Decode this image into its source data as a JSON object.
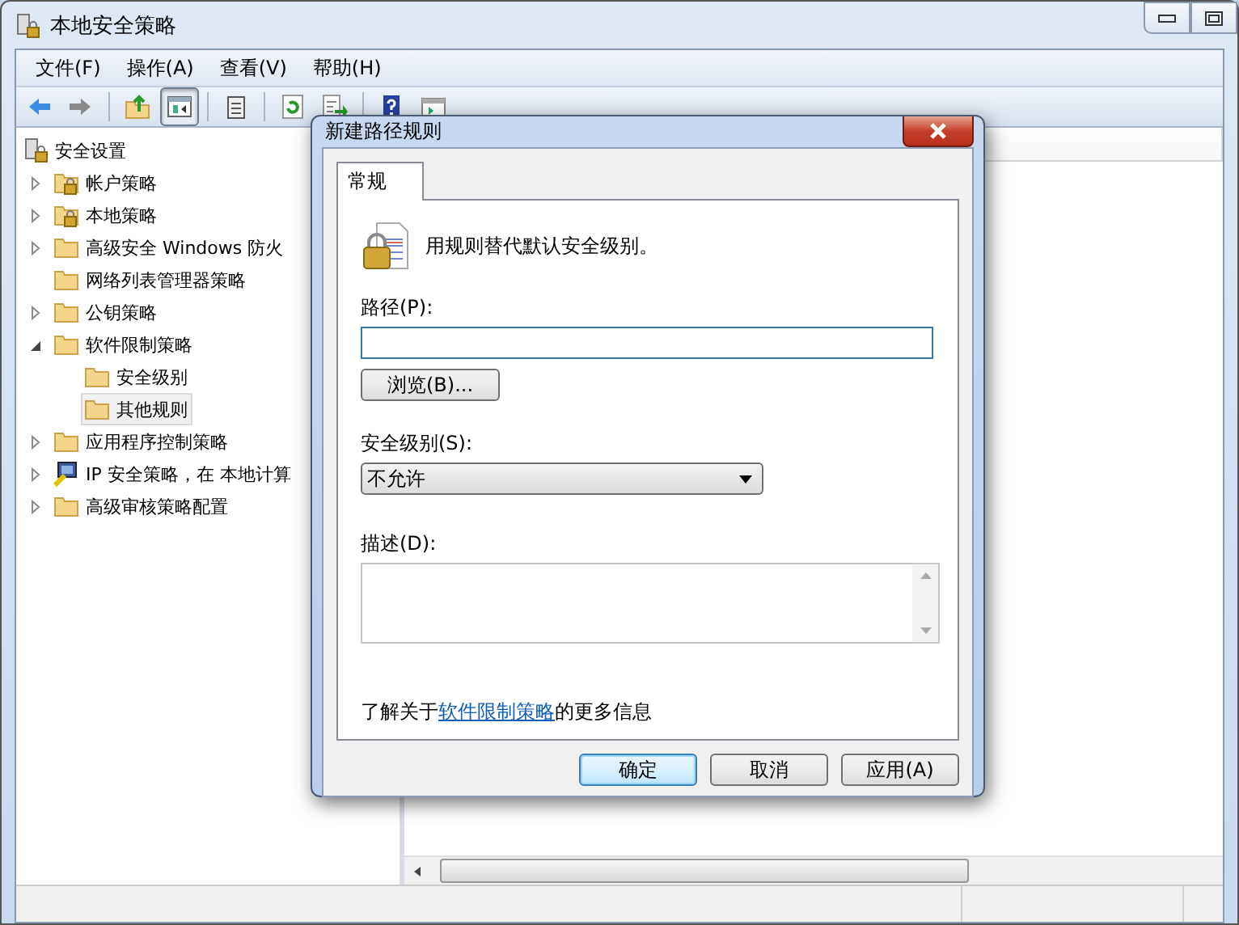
{
  "window": {
    "title": "本地安全策略"
  },
  "menu": [
    "文件(F)",
    "操作(A)",
    "查看(V)",
    "帮助(H)"
  ],
  "toolbar": [
    {
      "kind": "back",
      "pressed": false
    },
    {
      "kind": "forward",
      "pressed": false
    },
    {
      "kind": "up",
      "pressed": false
    },
    {
      "kind": "tree",
      "pressed": true
    },
    {
      "kind": "clipboard",
      "pressed": false
    },
    {
      "kind": "refresh",
      "pressed": false
    },
    {
      "kind": "export",
      "pressed": false
    },
    {
      "kind": "help",
      "pressed": false
    },
    {
      "kind": "panel",
      "pressed": false
    }
  ],
  "tree": [
    {
      "label": "安全设置",
      "kind": "policy",
      "selected": false,
      "children": [
        {
          "label": "帐户策略",
          "kind": "lock-folder",
          "selected": false,
          "expanded": false
        },
        {
          "label": "本地策略",
          "kind": "lock-folder",
          "selected": false,
          "expanded": false
        },
        {
          "label": "高级安全 Windows 防火",
          "kind": "folder",
          "selected": false,
          "expanded": false
        },
        {
          "label": "网络列表管理器策略",
          "kind": "folder",
          "selected": false
        },
        {
          "label": "公钥策略",
          "kind": "folder",
          "selected": false,
          "expanded": false
        },
        {
          "label": "软件限制策略",
          "kind": "folder",
          "selected": false,
          "expanded": true,
          "children": [
            {
              "label": "安全级别",
              "kind": "folder",
              "selected": false
            },
            {
              "label": "其他规则",
              "kind": "folder",
              "selected": true
            }
          ]
        },
        {
          "label": "应用程序控制策略",
          "kind": "folder",
          "selected": false,
          "expanded": false
        },
        {
          "label": "IP 安全策略，在 本地计算",
          "kind": "ip",
          "selected": false,
          "expanded": false
        },
        {
          "label": "高级审核策略配置",
          "kind": "folder",
          "selected": false,
          "expanded": false
        }
      ]
    }
  ],
  "dialog": {
    "title": "新建路径规则",
    "tabs": [
      {
        "label": "常规",
        "selected": true
      }
    ],
    "intro": "用规则替代默认安全级别。",
    "path": {
      "label": "路径(P):",
      "focused": true
    },
    "browse": "浏览(B)...",
    "level": {
      "label": "安全级别(S):",
      "value": "不允许"
    },
    "description": {
      "label": "描述(D):"
    },
    "info": {
      "before": "了解关于",
      "link": "软件限制策略",
      "after": "的更多信息"
    },
    "buttons": [
      {
        "label": "确定",
        "default": true
      },
      {
        "label": "取消",
        "default": false
      },
      {
        "label": "应用(A)",
        "default": false
      }
    ]
  }
}
